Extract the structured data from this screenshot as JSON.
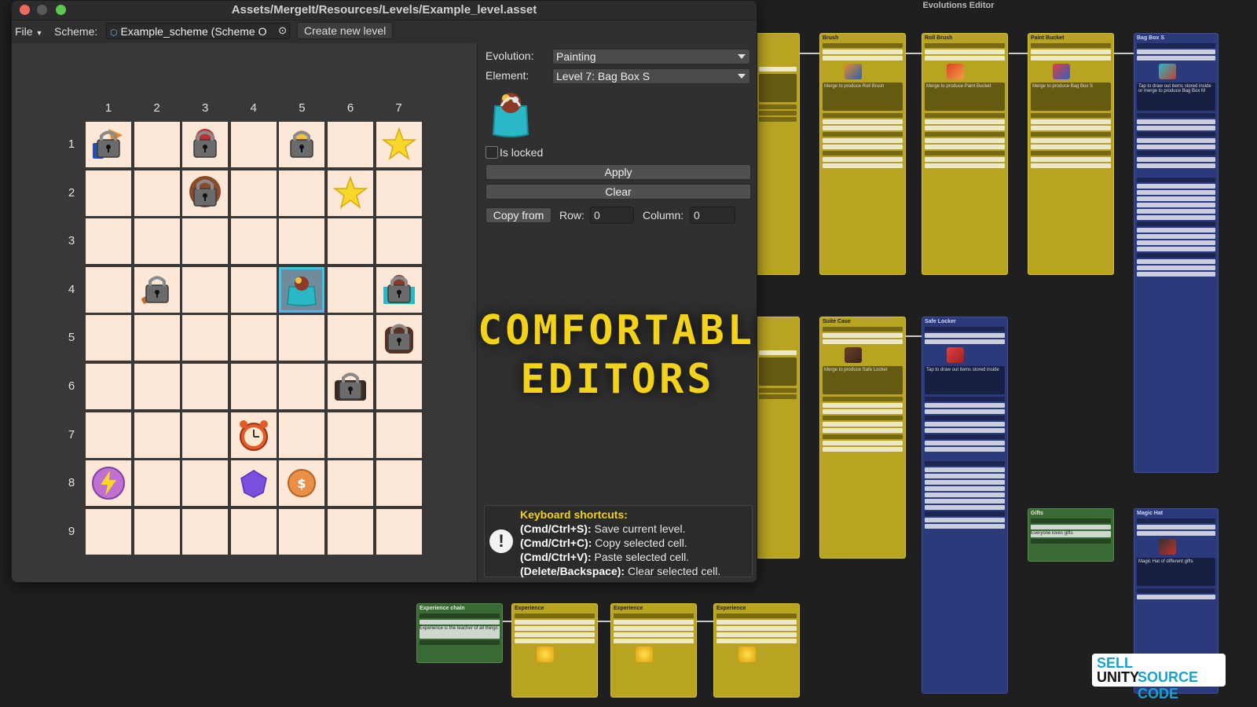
{
  "window": {
    "title": "Assets/MergeIt/Resources/Levels/Example_level.asset",
    "menu": {
      "file": "File",
      "scheme_label": "Scheme:",
      "scheme_value": "Example_scheme (Scheme O",
      "create": "Create new level"
    }
  },
  "grid": {
    "columns": [
      "1",
      "2",
      "3",
      "4",
      "5",
      "6",
      "7"
    ],
    "rows": [
      "1",
      "2",
      "3",
      "4",
      "5",
      "6",
      "7",
      "8",
      "9"
    ],
    "items": [
      {
        "row": 1,
        "col": 1,
        "icon": "locked-lightning-icon"
      },
      {
        "row": 1,
        "col": 3,
        "icon": "locked-painting-icon"
      },
      {
        "row": 1,
        "col": 5,
        "icon": "locked-bucket-icon"
      },
      {
        "row": 1,
        "col": 7,
        "icon": "star-icon"
      },
      {
        "row": 2,
        "col": 3,
        "icon": "locked-bag-icon"
      },
      {
        "row": 2,
        "col": 6,
        "icon": "star-icon"
      },
      {
        "row": 4,
        "col": 2,
        "icon": "locked-brush-icon"
      },
      {
        "row": 4,
        "col": 5,
        "icon": "bag-box-icon",
        "selected": true
      },
      {
        "row": 4,
        "col": 7,
        "icon": "locked-bag-box-icon"
      },
      {
        "row": 5,
        "col": 7,
        "icon": "locked-backpack-icon"
      },
      {
        "row": 6,
        "col": 6,
        "icon": "locked-suitcase-icon"
      },
      {
        "row": 7,
        "col": 4,
        "icon": "alarm-clock-icon"
      },
      {
        "row": 8,
        "col": 1,
        "icon": "energy-orb-icon"
      },
      {
        "row": 8,
        "col": 4,
        "icon": "purple-gem-icon"
      },
      {
        "row": 8,
        "col": 5,
        "icon": "coin-icon"
      }
    ]
  },
  "inspector": {
    "evolution_label": "Evolution:",
    "evolution_value": "Painting",
    "element_label": "Element:",
    "element_value": "Level 7: Bag Box S",
    "is_locked_label": "Is locked",
    "is_locked": false,
    "apply": "Apply",
    "clear": "Clear",
    "copy_from": "Copy from",
    "row_label": "Row:",
    "row_value": "0",
    "column_label": "Column:",
    "column_value": "0"
  },
  "headline": {
    "line1": "COMFORTABLE",
    "line2": "EDITORS"
  },
  "shortcuts": {
    "title": "Keyboard shortcuts:",
    "items": [
      {
        "key": "(Cmd/Ctrl+S):",
        "desc": "Save current level."
      },
      {
        "key": "(Cmd/Ctrl+C):",
        "desc": "Copy selected cell."
      },
      {
        "key": "(Cmd/Ctrl+V):",
        "desc": "Paste selected cell."
      },
      {
        "key": "(Delete/Backspace):",
        "desc": "Clear selected cell."
      }
    ]
  },
  "graph": {
    "title": "Evolutions Editor",
    "nodes": [
      {
        "title": "Brush",
        "desc": "Merge to produce Roll Brush"
      },
      {
        "title": "Roll Brush",
        "desc": "Merge to produce Paint Bucket"
      },
      {
        "title": "Paint Bucket",
        "desc": "Merge to produce Bag Box S"
      },
      {
        "title": "Bag Box S",
        "desc": "Tap to draw out items stored inside or merge to produce Bag Box M"
      },
      {
        "title": "Suite Case",
        "desc": "Merge to produce Safe Locker"
      },
      {
        "title": "Safe Locker",
        "desc": "Tap to draw out items stored inside"
      },
      {
        "title": "Gifts",
        "desc": "Everyone loves gifts"
      },
      {
        "title": "Magic Hat",
        "desc": "Magic Hat of different gifts"
      },
      {
        "title": "Experience chain",
        "desc": "Experience is the teacher of all things"
      },
      {
        "title": "Experience",
        "desc": ""
      },
      {
        "title": "Experience",
        "desc": ""
      },
      {
        "title": "Experience",
        "desc": ""
      }
    ]
  },
  "watermark": {
    "l1": "SELL",
    "l2": "UNITY",
    "l3": "SOURCE CODE"
  },
  "colors": {
    "accent": "#3ec4e8",
    "headline": "#f2d21a",
    "cell": "#fde8d8",
    "node_yellow": "#b8a421",
    "node_blue": "#2b3a7a"
  }
}
